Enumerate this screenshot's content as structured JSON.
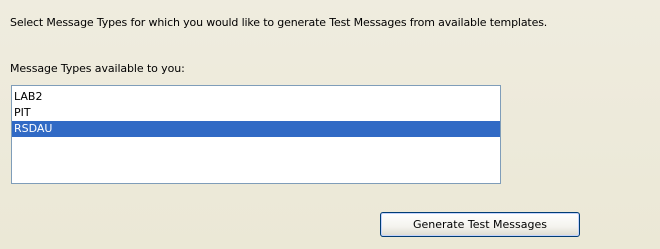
{
  "instructions": "Select Message Types for which you would like to generate Test Messages from available templates.",
  "list_label": "Message Types available to you:",
  "message_types": {
    "items": [
      {
        "label": "LAB2",
        "selected": false
      },
      {
        "label": "PIT",
        "selected": false
      },
      {
        "label": "RSDAU",
        "selected": true
      }
    ]
  },
  "generate_button_label": "Generate Test Messages",
  "colors": {
    "selection_background": "#316ac5",
    "panel_background": "#ece9d8",
    "list_border": "#7f9db9"
  }
}
